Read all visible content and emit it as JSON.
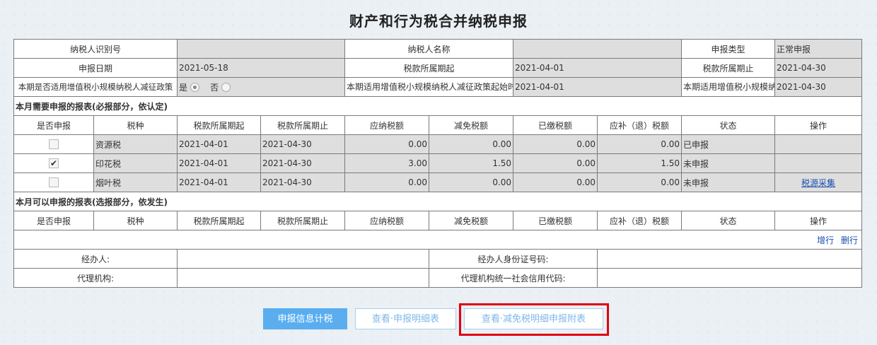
{
  "title": "财产和行为税合并纳税申报",
  "info": {
    "taxpayer_id_label": "纳税人识别号",
    "taxpayer_id_value": "",
    "taxpayer_name_label": "纳税人名称",
    "taxpayer_name_value": "",
    "decl_type_label": "申报类型",
    "decl_type_value": "正常申报",
    "decl_date_label": "申报日期",
    "decl_date_value": "2021-05-18",
    "period_start_label": "税款所属期起",
    "period_start_value": "2021-04-01",
    "period_end_label": "税款所属期止",
    "period_end_value": "2021-04-30",
    "policy_label": "本期是否适用增值税小规模纳税人减征政策",
    "policy_yes": "是",
    "policy_no": "否",
    "policy_start_label": "本期适用增值税小规模纳税人减征政策起始时间",
    "policy_start_value": "2021-04-01",
    "policy_end_label": "本期适用增值税小规模纳税人减征政策终止时间",
    "policy_end_value": "2021-04-30"
  },
  "columns": [
    "是否申报",
    "税种",
    "税款所属期起",
    "税款所属期止",
    "应纳税额",
    "减免税额",
    "已缴税额",
    "应补（退）税额",
    "状态",
    "操作"
  ],
  "section_required": "本月需要申报的报表(必报部分，依认定)",
  "required_rows": [
    {
      "checked": false,
      "tax": "资源税",
      "start": "2021-04-01",
      "end": "2021-04-30",
      "payable": "0.00",
      "relief": "0.00",
      "paid": "0.00",
      "due": "0.00",
      "status": "已申报",
      "op": ""
    },
    {
      "checked": true,
      "tax": "印花税",
      "start": "2021-04-01",
      "end": "2021-04-30",
      "payable": "3.00",
      "relief": "1.50",
      "paid": "0.00",
      "due": "1.50",
      "status": "未申报",
      "op": ""
    },
    {
      "checked": false,
      "tax": "烟叶税",
      "start": "2021-04-01",
      "end": "2021-04-30",
      "payable": "0.00",
      "relief": "0.00",
      "paid": "0.00",
      "due": "0.00",
      "status": "未申报",
      "op": "税源采集"
    }
  ],
  "section_optional": "本月可以申报的报表(选报部分，依发生)",
  "row_actions": {
    "add": "增行",
    "delete": "删行"
  },
  "footer": {
    "handler_label": "经办人:",
    "handler_id_label": "经办人身份证号码:",
    "agency_label": "代理机构:",
    "agency_code_label": "代理机构统一社会信用代码:"
  },
  "buttons": {
    "calc": "申报信息计税",
    "view_detail": "查看·申报明细表",
    "view_relief": "查看·减免税明细申报附表"
  },
  "colors": {
    "primary": "#5aaef0",
    "highlight": "#e0000f",
    "link": "#1a4fb0"
  }
}
